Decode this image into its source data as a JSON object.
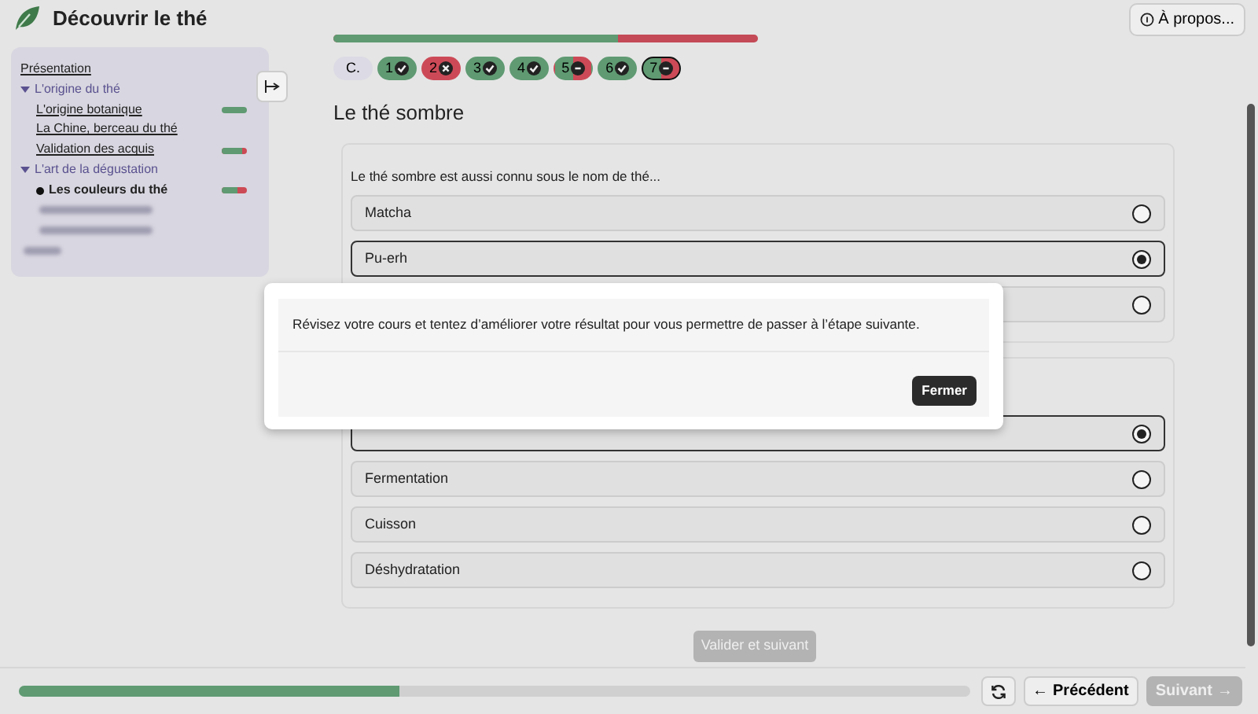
{
  "header": {
    "title": "Découvrir le thé",
    "about_button": "À propos..."
  },
  "sidebar": {
    "items": [
      {
        "kind": "link",
        "label": "Présentation"
      },
      {
        "kind": "section",
        "label": "L'origine du thé",
        "expanded": true,
        "children": [
          {
            "kind": "link",
            "label": "L'origine botanique",
            "level": 1
          },
          {
            "kind": "link",
            "label": "La Chine, berceau du thé"
          },
          {
            "kind": "link",
            "label": "Validation des acquis",
            "level": 0.8
          }
        ]
      },
      {
        "kind": "section",
        "label": "L'art de la dégustation",
        "expanded": true,
        "children": [
          {
            "kind": "link",
            "label": "Les couleurs du thé",
            "selected": true,
            "level": 0.65
          },
          {
            "kind": "blurred"
          },
          {
            "kind": "blurred"
          }
        ]
      },
      {
        "kind": "blurred"
      }
    ]
  },
  "quiz": {
    "score": {
      "level": 0.67
    },
    "steps": [
      {
        "label": "C.",
        "kind": "intro",
        "selected": false
      },
      {
        "label": "1",
        "kind": "correct",
        "selected": false
      },
      {
        "label": "2",
        "kind": "wrong",
        "selected": false
      },
      {
        "label": "3",
        "kind": "correct",
        "selected": false
      },
      {
        "label": "4",
        "kind": "correct",
        "selected": false
      },
      {
        "label": "5",
        "kind": "partial",
        "selected": false
      },
      {
        "label": "6",
        "kind": "correct",
        "selected": false
      },
      {
        "label": "7",
        "kind": "partial",
        "selected": true
      }
    ],
    "title": "Le thé sombre",
    "questions": [
      {
        "prompt": "Le thé sombre est aussi connu sous le nom de thé...",
        "options": [
          {
            "label": "Matcha",
            "selected": false
          },
          {
            "label": "Pu-erh",
            "selected": true
          },
          {
            "selected": false
          }
        ]
      },
      {
        "options": [
          {
            "selected": true
          },
          {
            "label": "Fermentation",
            "selected": false
          },
          {
            "label": "Cuisson",
            "selected": false
          },
          {
            "label": "Déshydratation",
            "selected": false
          }
        ]
      }
    ],
    "submit": {
      "label": "Valider et suivant",
      "disabled": true
    }
  },
  "footer": {
    "progress": {
      "level": 0.4
    },
    "previous": "Précédent",
    "previous_arrow": "←",
    "next": "Suivant",
    "next_arrow": "→",
    "next_disabled": true
  },
  "dialog": {
    "message": "Révisez votre cours et tentez d’améliorer votre résultat pour vous permettre de passer à l’étape suivante.",
    "close": "Fermer"
  }
}
